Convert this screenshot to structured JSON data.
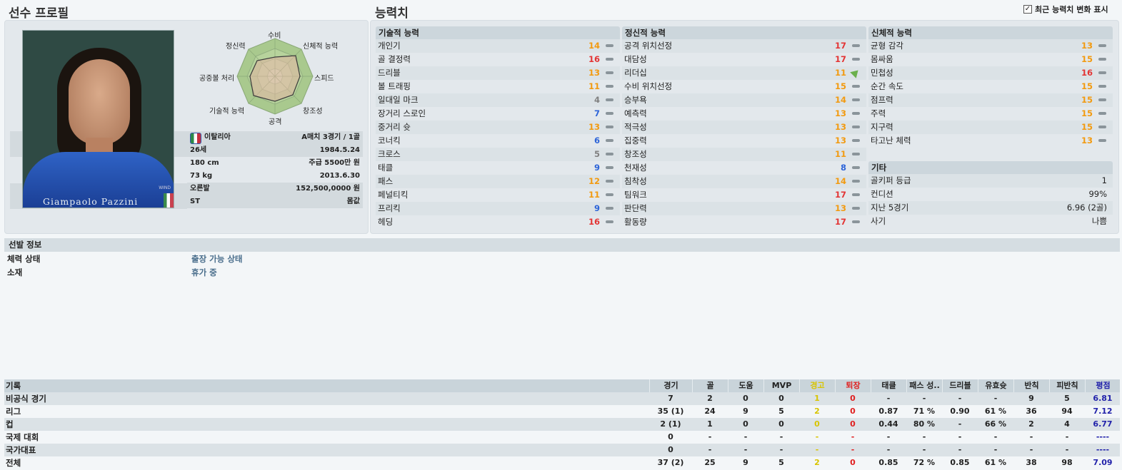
{
  "titles": {
    "profile": "선수 프로필",
    "attributes": "능력치",
    "show_changes": "최근 능력치 변화 표시"
  },
  "profile": {
    "photo_name": "Giampaolo Pazzini",
    "photo_sponsor": "WIND",
    "radar_labels": [
      "수비",
      "신체적 능력",
      "스피드",
      "창조성",
      "공격",
      "기술적 능력",
      "공중볼 처리",
      "정신력"
    ],
    "info": [
      {
        "left": "이탈리아",
        "right": "A매치 3경기 / 1골"
      },
      {
        "left": "26세",
        "right": "1984.5.24"
      },
      {
        "left": "180 cm",
        "right": "주급 5500만 원"
      },
      {
        "left": "73 kg",
        "right": "2013.6.30"
      },
      {
        "left": "오른발",
        "right": "152,500,0000 원"
      },
      {
        "left": "ST",
        "right": "몸값"
      }
    ]
  },
  "technical": {
    "title": "기술적 능력",
    "rows": [
      {
        "name": "개인기",
        "value": "14",
        "color": "#f29a10"
      },
      {
        "name": "골 결정력",
        "value": "16",
        "color": "#e33434"
      },
      {
        "name": "드리블",
        "value": "13",
        "color": "#f29a10"
      },
      {
        "name": "볼 트래핑",
        "value": "11",
        "color": "#f29a10"
      },
      {
        "name": "일대일 마크",
        "value": "4",
        "color": "#808080"
      },
      {
        "name": "장거리 스로인",
        "value": "7",
        "color": "#2d64d8"
      },
      {
        "name": "중거리 슛",
        "value": "13",
        "color": "#f29a10"
      },
      {
        "name": "코너킥",
        "value": "6",
        "color": "#2d64d8"
      },
      {
        "name": "크로스",
        "value": "5",
        "color": "#808080"
      },
      {
        "name": "태클",
        "value": "9",
        "color": "#2d64d8"
      },
      {
        "name": "패스",
        "value": "12",
        "color": "#f29a10"
      },
      {
        "name": "페널티킥",
        "value": "11",
        "color": "#f29a10"
      },
      {
        "name": "프리킥",
        "value": "9",
        "color": "#2d64d8"
      },
      {
        "name": "헤딩",
        "value": "16",
        "color": "#e33434"
      }
    ]
  },
  "mental": {
    "title": "정신적 능력",
    "rows": [
      {
        "name": "공격 위치선정",
        "value": "17",
        "color": "#e33434"
      },
      {
        "name": "대담성",
        "value": "17",
        "color": "#e33434"
      },
      {
        "name": "리더십",
        "value": "11",
        "color": "#f29a10",
        "trend": "up"
      },
      {
        "name": "수비 위치선정",
        "value": "15",
        "color": "#f29a10"
      },
      {
        "name": "승부욕",
        "value": "14",
        "color": "#f29a10"
      },
      {
        "name": "예측력",
        "value": "13",
        "color": "#f29a10"
      },
      {
        "name": "적극성",
        "value": "13",
        "color": "#f29a10"
      },
      {
        "name": "집중력",
        "value": "13",
        "color": "#f29a10"
      },
      {
        "name": "창조성",
        "value": "11",
        "color": "#f29a10"
      },
      {
        "name": "천재성",
        "value": "8",
        "color": "#2d64d8"
      },
      {
        "name": "침착성",
        "value": "14",
        "color": "#f29a10"
      },
      {
        "name": "팀워크",
        "value": "17",
        "color": "#e33434"
      },
      {
        "name": "판단력",
        "value": "13",
        "color": "#f29a10"
      },
      {
        "name": "활동량",
        "value": "17",
        "color": "#e33434"
      }
    ]
  },
  "physical": {
    "title": "신체적 능력",
    "rows": [
      {
        "name": "균형 감각",
        "value": "13",
        "color": "#f29a10"
      },
      {
        "name": "몸싸움",
        "value": "15",
        "color": "#f29a10"
      },
      {
        "name": "민첩성",
        "value": "16",
        "color": "#e33434"
      },
      {
        "name": "순간 속도",
        "value": "15",
        "color": "#f29a10"
      },
      {
        "name": "점프력",
        "value": "15",
        "color": "#f29a10"
      },
      {
        "name": "주력",
        "value": "15",
        "color": "#f29a10"
      },
      {
        "name": "지구력",
        "value": "15",
        "color": "#f29a10"
      },
      {
        "name": "타고난 체력",
        "value": "13",
        "color": "#f29a10"
      }
    ]
  },
  "misc": {
    "title": "기타",
    "rows": [
      {
        "name": "골키퍼 등급",
        "value": "1"
      },
      {
        "name": "컨디션",
        "value": "99%"
      },
      {
        "name": "지난 5경기",
        "value": "6.96 (2골)"
      },
      {
        "name": "사기",
        "value": "나쁨"
      }
    ]
  },
  "selection": {
    "title": "선발 정보",
    "rows": [
      {
        "name": "체력 상태",
        "value": "출장 가능 상태"
      },
      {
        "name": "소재",
        "value": "휴가 중"
      }
    ]
  },
  "records": {
    "title": "기록",
    "columns": [
      "경기",
      "골",
      "도움",
      "MVP",
      "경고",
      "퇴장",
      "태클",
      "패스 성..",
      "드리블",
      "유효슛",
      "반칙",
      "피반칙",
      "평점"
    ],
    "column_colors": {
      "경고": "#d8c400",
      "퇴장": "#e02020",
      "평점": "#2222aa"
    },
    "rows": [
      {
        "label": "비공식 경기",
        "cells": [
          "7",
          "2",
          "0",
          "0",
          "1",
          "0",
          "-",
          "-",
          "-",
          "-",
          "9",
          "5",
          "6.81"
        ]
      },
      {
        "label": "리그",
        "cells": [
          "35 (1)",
          "24",
          "9",
          "5",
          "2",
          "0",
          "0.87",
          "71 %",
          "0.90",
          "61 %",
          "36",
          "94",
          "7.12"
        ]
      },
      {
        "label": "컵",
        "cells": [
          "2 (1)",
          "1",
          "0",
          "0",
          "0",
          "0",
          "0.44",
          "80 %",
          "-",
          "66 %",
          "2",
          "4",
          "6.77"
        ]
      },
      {
        "label": "국제 대회",
        "cells": [
          "0",
          "-",
          "-",
          "-",
          "-",
          "-",
          "-",
          "-",
          "-",
          "-",
          "-",
          "-",
          "----"
        ]
      },
      {
        "label": "국가대표",
        "cells": [
          "0",
          "-",
          "-",
          "-",
          "-",
          "-",
          "-",
          "-",
          "-",
          "-",
          "-",
          "-",
          "----"
        ]
      },
      {
        "label": "전체",
        "cells": [
          "37 (2)",
          "25",
          "9",
          "5",
          "2",
          "0",
          "0.85",
          "72 %",
          "0.85",
          "61 %",
          "38",
          "98",
          "7.09"
        ]
      }
    ]
  }
}
